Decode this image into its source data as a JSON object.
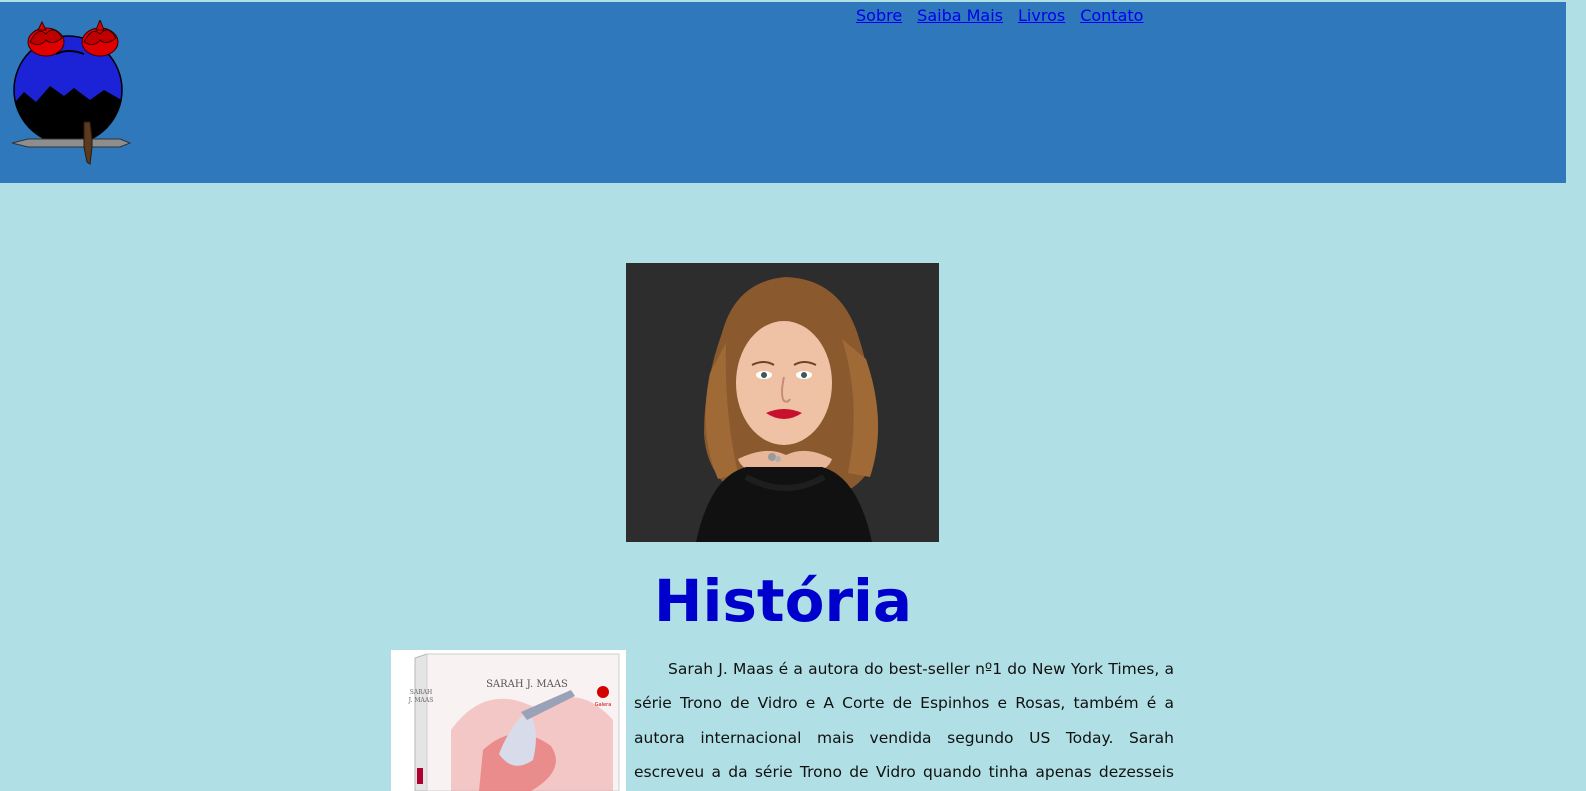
{
  "nav": {
    "items": [
      {
        "label": "Sobre"
      },
      {
        "label": "Saiba Mais"
      },
      {
        "label": "Livros"
      },
      {
        "label": "Contato"
      }
    ]
  },
  "main": {
    "title": "História",
    "paragraph": "Sarah J. Maas é a autora do best-seller nº1 do New York Times, a série Trono de Vidro e A Corte de Espinhos e Rosas, também é a autora internacional mais vendida segundo US Today. Sarah escreveu a da série Trono de Vidro quando tinha apenas dezesseis anos, e já vendeu em"
  },
  "book_cover": {
    "author": "SARAH J. MAAS",
    "spine_author_line1": "SARAH",
    "spine_author_line2": "J. MAAS",
    "publisher": "Galera"
  },
  "colors": {
    "header_bg": "#2e78bb",
    "page_bg": "#b0e0e6",
    "title": "#0000cd",
    "link": "#0000ee"
  },
  "icons": {
    "logo": "rose-mountain-sword-emblem"
  }
}
